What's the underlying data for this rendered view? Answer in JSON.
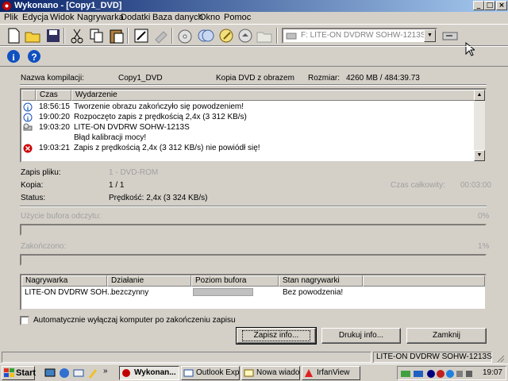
{
  "window": {
    "title": "Wykonano - [Copy1_DVD]"
  },
  "menu": [
    "Plik",
    "Edycja",
    "Widok",
    "Nagrywarka",
    "Dodatki",
    "Baza danych",
    "Okno",
    "Pomoc"
  ],
  "toolbar": {
    "drive_selector": "F: LITE-ON  DVDRW SOHW-1213S"
  },
  "info": {
    "compilation_label": "Nazwa kompilacji:",
    "compilation_value": "Copy1_DVD",
    "type": "Kopia DVD z obrazem",
    "size_label": "Rozmiar:",
    "size_value": "4260 MB   /   484:39.73"
  },
  "log": {
    "headers": [
      "Czas",
      "Wydarzenie"
    ],
    "rows": [
      {
        "icon": "info-icon",
        "time": "18:56:15",
        "text": "Tworzenie obrazu zakończyło się powodzeniem!"
      },
      {
        "icon": "info-icon",
        "time": "19:00:20",
        "text": "Rozpoczęto zapis z prędkością 2,4x (3 312 KB/s)"
      },
      {
        "icon": "drive-icon",
        "time": "19:03:20",
        "text": "LITE-ON  DVDRW SOHW-1213S"
      },
      {
        "icon": "",
        "time": "",
        "text": "Błąd kalibracji mocy!"
      },
      {
        "icon": "error-icon",
        "time": "19:03:21",
        "text": "Zapis z prędkością 2,4x (3 312 KB/s) nie powiódł się!"
      }
    ]
  },
  "details": {
    "file_write_label": "Zapis pliku:",
    "file_write_value": "1 - DVD-ROM",
    "copy_label": "Kopia:",
    "copy_value": "1 / 1",
    "status_label": "Status:",
    "status_value": "Prędkość: 2,4x (3 324 KB/s)",
    "total_time_label": "Czas całkowity:",
    "total_time_value": "00:03:00"
  },
  "progress": {
    "read_buffer_label": "Użycie bufora odczytu:",
    "read_buffer_value": "0%",
    "completed_label": "Zakończono:",
    "completed_value": "1%"
  },
  "drives": {
    "headers": [
      "Nagrywarka",
      "Działanie",
      "Poziom bufora",
      "Stan nagrywarki"
    ],
    "rows": [
      {
        "recorder": "LITE-ON DVDRW SOH...",
        "action": "bezczynny",
        "buffer": "",
        "state": "Bez powodzenia!"
      }
    ]
  },
  "auto_shutdown_label": "Automatycznie wyłączaj komputer po zakończeniu zapisu",
  "buttons": {
    "save_info": "Zapisz info...",
    "print_info": "Drukuj info...",
    "close": "Zamknij"
  },
  "statusbar": {
    "drive": "LITE-ON  DVDRW SOHW-1213S"
  },
  "taskbar": {
    "start": "Start",
    "tasks": [
      "Wykonan...",
      "Outlook Exp...",
      "Nowa wiado...",
      "IrfanView"
    ],
    "clock": "19:07"
  },
  "colors": {
    "titlebar_start": "#0a246a",
    "titlebar_end": "#a6caf0",
    "face": "#d4d0c8",
    "error": "#cc0000"
  }
}
